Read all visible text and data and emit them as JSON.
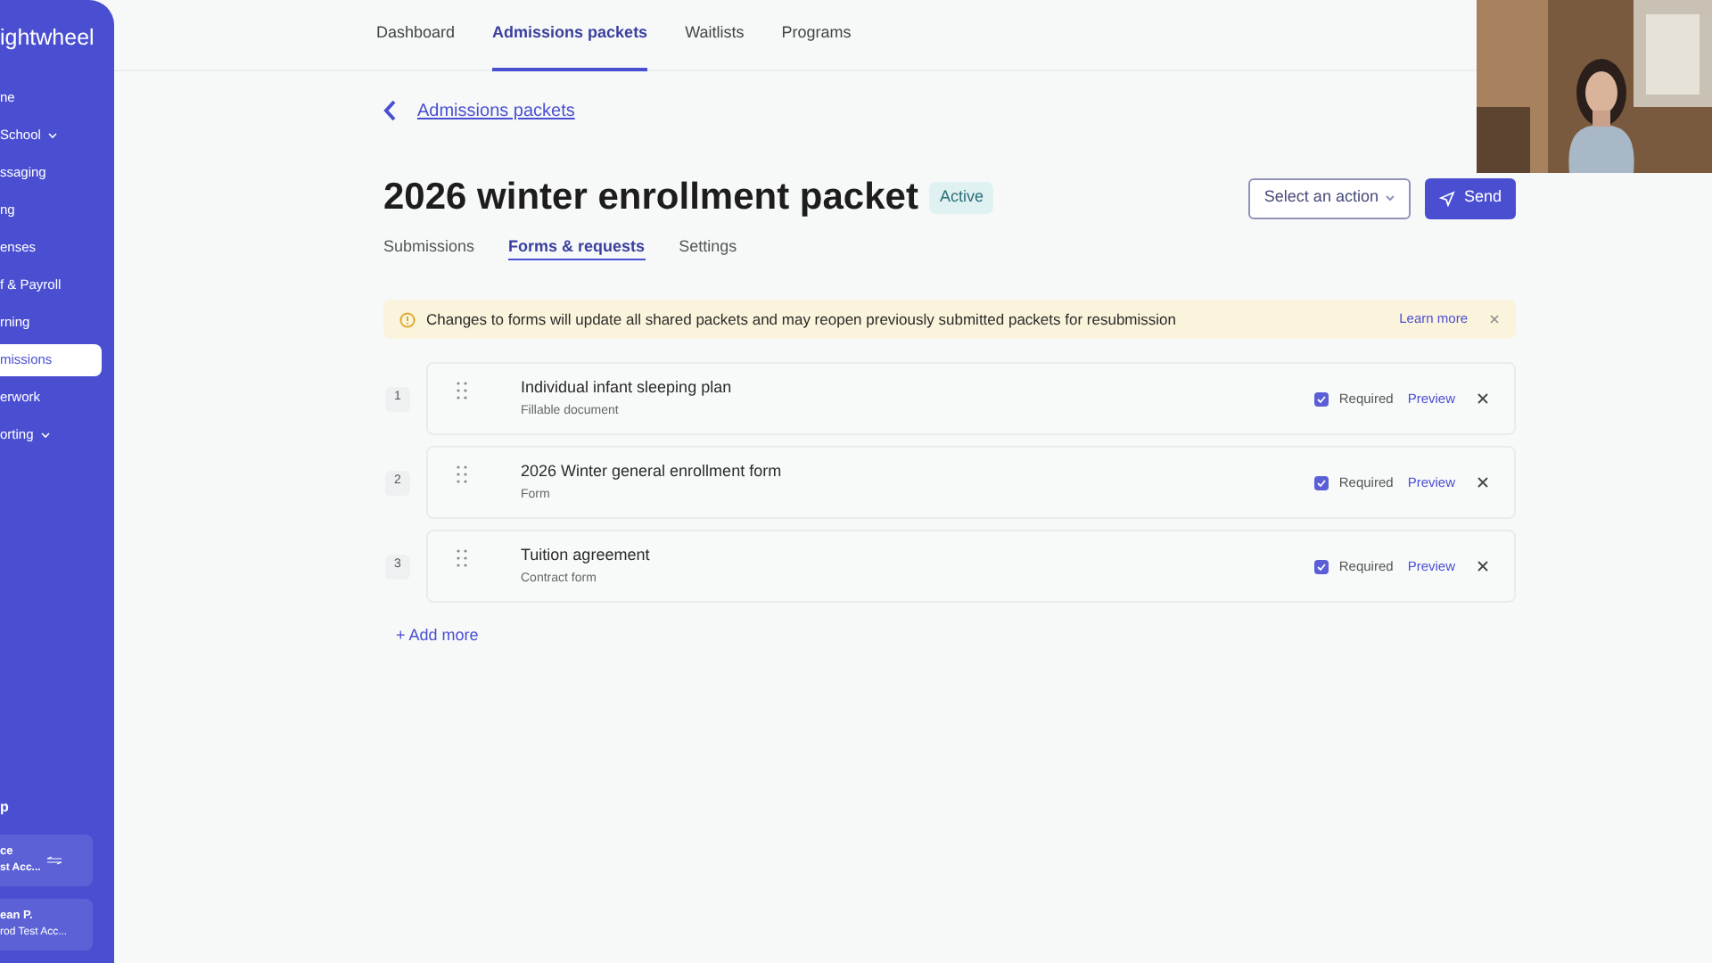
{
  "sidebar": {
    "logo": "ightwheel",
    "items": [
      {
        "label": "ne",
        "selected": false,
        "expandable": false
      },
      {
        "label": "School",
        "selected": false,
        "expandable": true
      },
      {
        "label": "ssaging",
        "selected": false,
        "expandable": false
      },
      {
        "label": "ng",
        "selected": false,
        "expandable": false
      },
      {
        "label": "enses",
        "selected": false,
        "expandable": false
      },
      {
        "label": "f & Payroll",
        "selected": false,
        "expandable": false
      },
      {
        "label": "rning",
        "selected": false,
        "expandable": false
      },
      {
        "label": "missions",
        "selected": true,
        "expandable": false
      },
      {
        "label": "erwork",
        "selected": false,
        "expandable": false
      },
      {
        "label": "orting",
        "selected": false,
        "expandable": true
      }
    ],
    "help": "p",
    "accounts": [
      {
        "line_1": "ce",
        "line_2": "st Acc...",
        "switch": true
      },
      {
        "line_1": "ean P.",
        "line_2": "rod Test Acc...",
        "switch": false
      }
    ]
  },
  "top_nav": [
    {
      "label": "Dashboard",
      "selected": false
    },
    {
      "label": "Admissions packets",
      "selected": true
    },
    {
      "label": "Waitlists",
      "selected": false
    },
    {
      "label": "Programs",
      "selected": false
    }
  ],
  "back_link": "Admissions packets",
  "title": "2026 winter enrollment packet",
  "status_badge": "Active",
  "action_select": "Select an action",
  "send_button": "Send",
  "tabs": [
    {
      "label": "Submissions",
      "selected": false
    },
    {
      "label": "Forms & requests",
      "selected": true
    },
    {
      "label": "Settings",
      "selected": false
    }
  ],
  "banner": {
    "message": "Changes to forms will update all shared packets and may reopen previously submitted packets for resubmission",
    "link": "Learn more"
  },
  "forms": [
    {
      "number": "1",
      "title": "Individual infant sleeping plan",
      "type": "Fillable document",
      "required": true,
      "required_label": "Required",
      "preview": "Preview"
    },
    {
      "number": "2",
      "title": "2026 Winter general enrollment form",
      "type": "Form",
      "required": true,
      "required_label": "Required",
      "preview": "Preview"
    },
    {
      "number": "3",
      "title": "Tuition agreement",
      "type": "Contract form",
      "required": true,
      "required_label": "Required",
      "preview": "Preview"
    }
  ],
  "add_more": "+ Add more"
}
